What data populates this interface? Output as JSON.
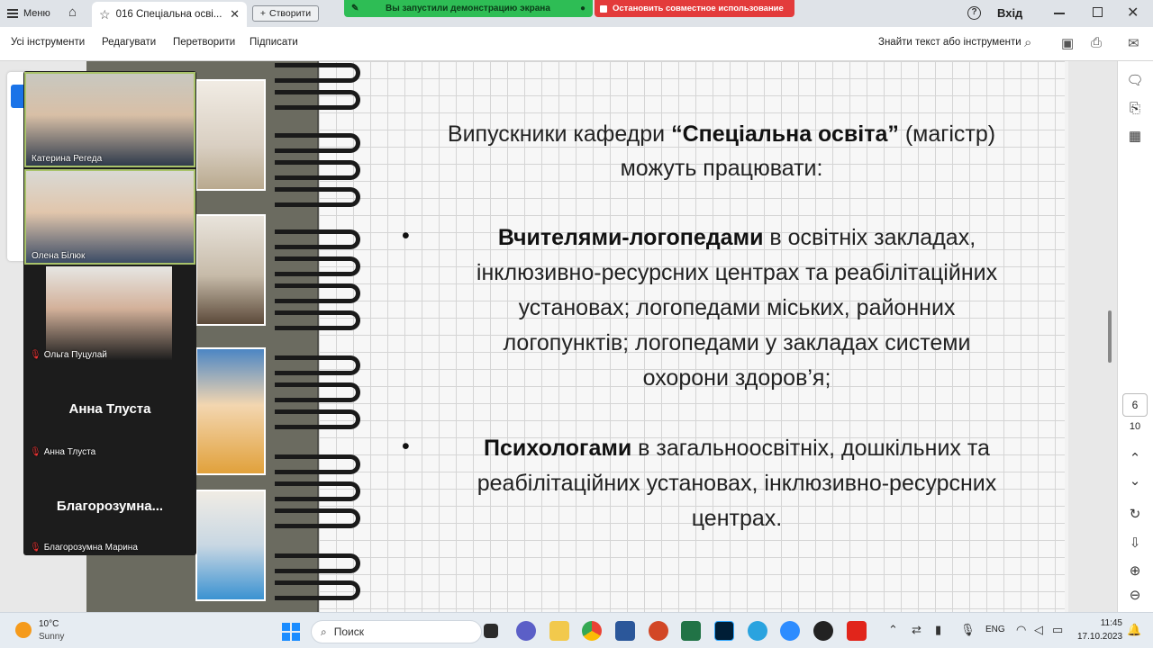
{
  "tabbar": {
    "menu_label": "Меню",
    "doc_tab_title": "016 Спеціальна осві...",
    "create_label": "Створити",
    "sign_in": "Вхід"
  },
  "share_bar": {
    "status_text": "Вы запустили демонстрацию экрана",
    "stop_text": "Остановить совместное использование",
    "status_color": "#2ebd55",
    "stop_color": "#e33b3b"
  },
  "toolbar": {
    "all_tools": "Усі інструменти",
    "edit": "Редагувати",
    "convert": "Перетворити",
    "sign": "Підписати",
    "find": "Знайти текст або інструменти"
  },
  "slide": {
    "title_part1": "Випускники  кафедри ",
    "title_bold": "“Спеціальна освіта”",
    "title_part2": "  (магістр)",
    "title_line2": "можуть працювати:",
    "bullet1_bold": "Вчителями-логопедами",
    "bullet1_rest_line1": " в освітніх закладах,",
    "bullet1_line2": "інклюзивно-ресурсних центрах та реабілітаційних",
    "bullet1_line3": "установах; логопедами міських, районних",
    "bullet1_line4": "логопунктів; логопедами у закладах системи",
    "bullet1_line5": "охорони здоров’я;",
    "bullet2_bold": "Психологами",
    "bullet2_rest_line1": " в загальноосвітніх, дошкільних та",
    "bullet2_line2": "реабілітаційних установах, інклюзивно-ресурсних",
    "bullet2_line3": "центрах."
  },
  "pager": {
    "current_page": "6",
    "total_pages": "10"
  },
  "participants": [
    {
      "name": "Катерина Регеда",
      "video": true,
      "muted": false
    },
    {
      "name": "Олена Білюк",
      "video": true,
      "muted": false
    },
    {
      "name": "Ольга Пуцулай",
      "video": true,
      "muted": true
    },
    {
      "name": "Анна Тлуста",
      "center": "Анна Тлуста",
      "video": false,
      "muted": true
    },
    {
      "name": "Благорозумна Марина",
      "center": "Благорозумна...",
      "video": false,
      "muted": true
    }
  ],
  "taskbar": {
    "temp": "10°C",
    "weather": "Sunny",
    "search_placeholder": "Поиск",
    "lang": "ENG",
    "time": "11:45",
    "date": "17.10.2023"
  }
}
